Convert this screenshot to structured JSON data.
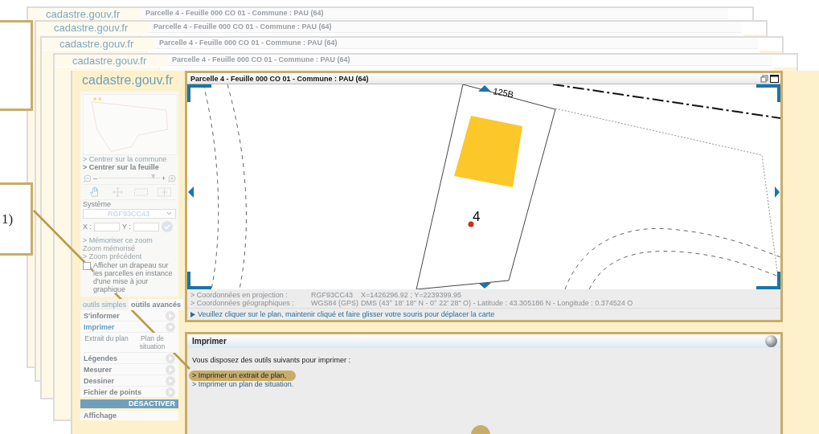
{
  "back_windows": [
    {
      "logo": "cadastre.gouv.fr",
      "title": "Parcelle 4 - Feuille 000 CO 01 - Commune : PAU (64)"
    },
    {
      "logo": "cadastre.gouv.fr",
      "title": "Parcelle 4 - Feuille 000 CO 01 - Commune : PAU (64)"
    },
    {
      "logo": "cadastre.gouv.fr",
      "title": "Parcelle 4 - Feuille 000 CO 01 - Commune : PAU (64)"
    },
    {
      "logo": "cadastre.gouv.fr",
      "title": "Parcelle 4 - Feuille 000 CO 01 - Commune : PAU (64)"
    }
  ],
  "callout_label": "1)",
  "sidebar": {
    "logo": "cadastre.gouv.fr",
    "links": [
      {
        "label": "> Centrer sur la commune",
        "bold": false
      },
      {
        "label": "> Centrer sur la feuille",
        "bold": true
      }
    ],
    "zoom": {
      "minus": "–",
      "plus": "+",
      "level": 0.9
    },
    "system_label": "Système",
    "system_value": "RGF93CC43",
    "x_label": "X :",
    "y_label": "Y :",
    "zoom_links": [
      {
        "label": "> Mémoriser ce zoom",
        "disabled": false
      },
      {
        "label": "Zoom mémorisé",
        "disabled": true
      },
      {
        "label": "> Zoom précédent",
        "disabled": true
      }
    ],
    "flag_checkbox": {
      "label": "Afficher un drapeau sur les parcelles en instance d'une mise à jour graphique",
      "checked": false
    },
    "tabs": [
      {
        "label": "outils simples",
        "selected": false
      },
      {
        "label": "outils avancés",
        "selected": true
      }
    ],
    "tools": [
      {
        "label": "S'informer",
        "expanded": false
      },
      {
        "label": "Imprimer",
        "expanded": true,
        "children": [
          "Extrait du plan",
          "Plan de situation"
        ]
      },
      {
        "label": "Légendes",
        "expanded": false
      },
      {
        "label": "Mesurer",
        "expanded": false
      },
      {
        "label": "Dessiner",
        "expanded": false
      },
      {
        "label": "Fichier de points",
        "expanded": false
      }
    ],
    "deactivate": "DÉSACTIVER",
    "display": "Affichage"
  },
  "map": {
    "title": "Parcelle 4 - Feuille 000 CO 01 - Commune : PAU (64)",
    "parcel_number": "4",
    "neighbor_label": "125B"
  },
  "coordinates": {
    "rows": [
      {
        "label": "> Coordonnées en projection :",
        "system": "RGF93CC43",
        "value": "X=1426296.92 ; Y=2239399.95"
      },
      {
        "label": "> Coordonnées géographiques :",
        "system": "WGS84 (GPS)",
        "value": "DMS (43° 18' 18\" N - 0° 22' 28\" O) - Latitude : 43.305186 N - Longitude : 0.374524 O"
      }
    ],
    "hint": "Veuillez cliquer sur le plan, maintenir cliqué et faire glisser votre souris pour déplacer la carte"
  },
  "print_panel": {
    "title": "Imprimer",
    "intro": "Vous disposez des outils suivants pour imprimer :",
    "links": [
      {
        "label": "> Imprimer un extrait de plan,",
        "highlighted": true
      },
      {
        "label": "> Imprimer un plan de situation.",
        "highlighted": false
      }
    ]
  }
}
